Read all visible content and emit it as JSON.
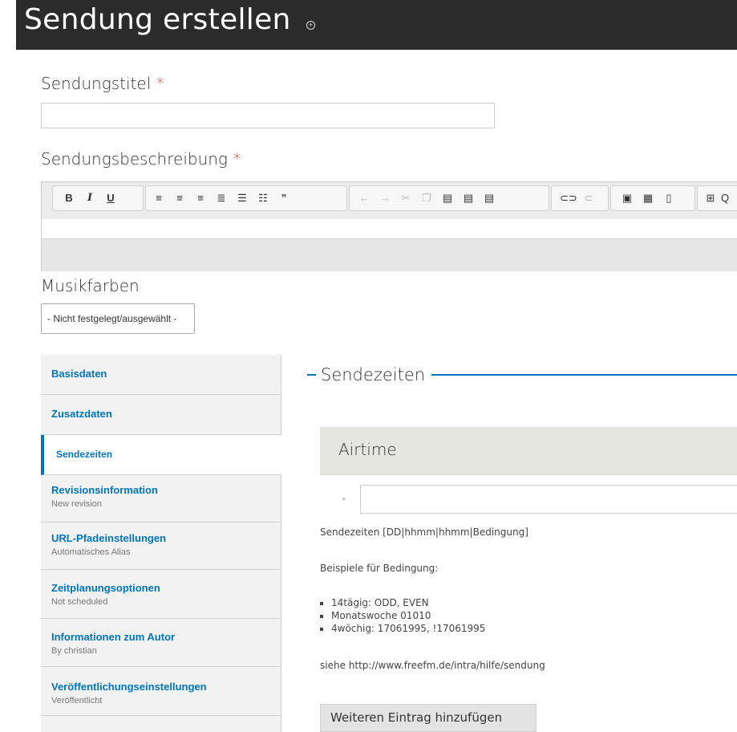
{
  "page": {
    "title": "Sendung erstellen",
    "title_icon": "circle-plus-icon"
  },
  "fields": {
    "title_label": "Sendungstitel",
    "title_value": "",
    "description_label": "Sendungsbeschreibung",
    "required_mark": "*",
    "music_label": "Musikfarben",
    "music_selected": "- Nicht festgelegt/ausgewählt -"
  },
  "editor": {
    "buttons": [
      "B",
      "I",
      "U",
      "align-left-icon",
      "align-center-icon",
      "align-right-icon",
      "justify-icon",
      "bullet-list-icon",
      "numbered-list-icon",
      "blockquote-icon",
      "undo-icon",
      "redo-icon",
      "cut-icon",
      "copy-icon",
      "paste-icon",
      "paste-text-icon",
      "paste-word-icon",
      "link-icon",
      "unlink-icon",
      "image-icon",
      "table-icon",
      "template-icon",
      "source-icon"
    ]
  },
  "tabs": [
    {
      "label": "Basisdaten",
      "summary": ""
    },
    {
      "label": "Zusatzdaten",
      "summary": ""
    },
    {
      "label": "Sendezeiten",
      "summary": ""
    },
    {
      "label": "Revisionsinformation",
      "summary": "New revision"
    },
    {
      "label": "URL-Pfadeinstellungen",
      "summary": "Automatisches Alias"
    },
    {
      "label": "Zeitplanungsoptionen",
      "summary": "Not scheduled"
    },
    {
      "label": "Informationen zum Autor",
      "summary": "By christian"
    },
    {
      "label": "Veröffentlichungseinstellungen",
      "summary": "Veröffentlicht"
    }
  ],
  "active_tab": "Sendezeiten",
  "sendezeiten": {
    "legend": "Sendezeiten",
    "airtime_header": "Airtime",
    "airtime_value": "",
    "format_hint": "Sendezeiten [DD|hhmm|hhmm|Bedingung]",
    "examples_label": "Beispiele für Bedingung:",
    "examples": [
      "14tägig: ODD, EVEN",
      "Monatswoche 01010",
      "4wöchig: 17061995, !17061995"
    ],
    "help_text": "siehe http://www.freefm.de/intra/hilfe/sendung",
    "add_button": "Weiteren Eintrag hinzufügen"
  },
  "colors": {
    "header_bg": "#2b2b2b",
    "link_blue": "#0074bd",
    "required_red": "#e0281f"
  }
}
